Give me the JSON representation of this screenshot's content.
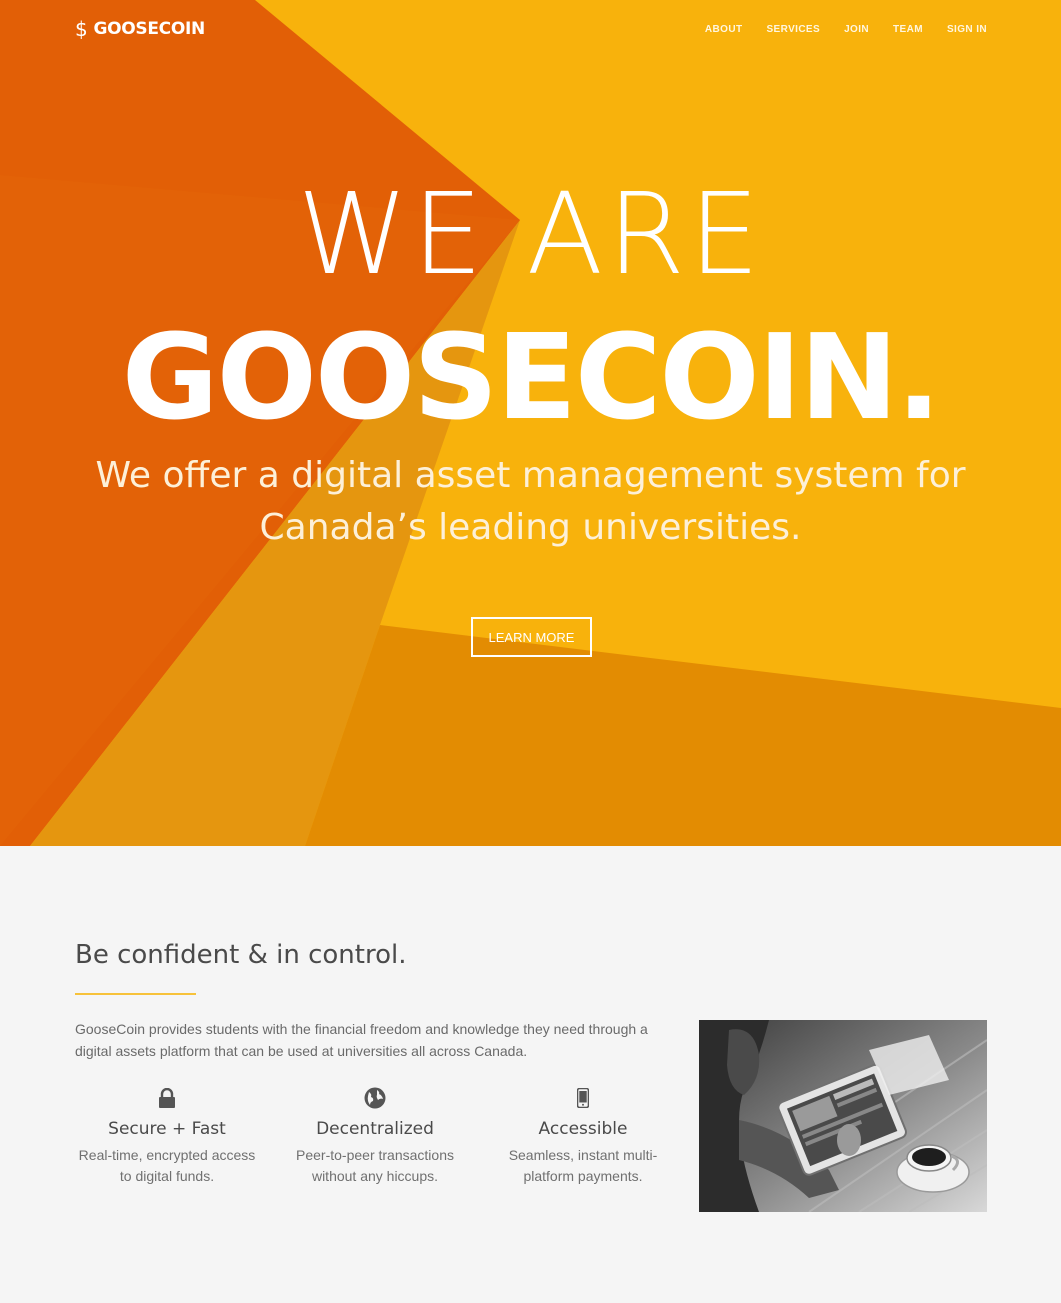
{
  "nav": {
    "logo_symbol": "$",
    "logo_text": "GOOSECOIN",
    "items": [
      {
        "label": "ABOUT"
      },
      {
        "label": "SERVICES"
      },
      {
        "label": "JOIN"
      },
      {
        "label": "TEAM"
      },
      {
        "label": "SIGN IN"
      }
    ]
  },
  "hero": {
    "line1": "WE ARE",
    "line2": "GOOSECOIN.",
    "subtitle": "We offer a digital asset management system for Canada’s leading universities.",
    "cta_label": "LEARN MORE"
  },
  "section": {
    "title": "Be confident & in control.",
    "intro": "GooseCoin provides students with the financial freedom and knowledge they need through a digital assets platform that can be used at universities all across Canada.",
    "features": [
      {
        "icon": "lock-icon",
        "title": "Secure + Fast",
        "desc": "Real-time, encrypted access to digital funds."
      },
      {
        "icon": "globe-icon",
        "title": "Decentralized",
        "desc": "Peer-to-peer transactions without any hiccups."
      },
      {
        "icon": "mobile-phone-icon",
        "title": "Accessible",
        "desc": "Seamless, instant multi-platform payments."
      }
    ]
  },
  "colors": {
    "hero_yellow": "#f8b20c",
    "hero_orange": "#e25f06",
    "hero_amber": "#e38c02",
    "accent_underline": "#f7c23a"
  }
}
